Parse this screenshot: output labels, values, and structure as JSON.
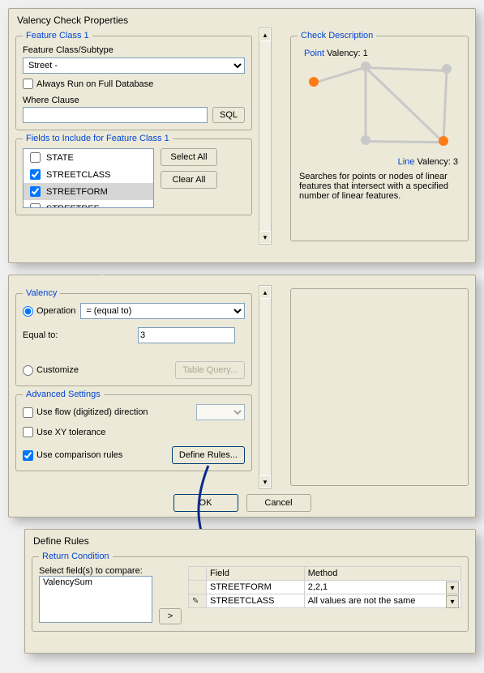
{
  "dialog1": {
    "title": "Valency Check Properties",
    "featureClass": {
      "legend": "Feature Class 1",
      "subtypeLabel": "Feature Class/Subtype",
      "subtypeValue": "Street - ",
      "alwaysRun": {
        "label": "Always Run on Full Database",
        "checked": false
      },
      "whereLabel": "Where Clause",
      "whereValue": "",
      "sqlBtn": "SQL"
    },
    "fields": {
      "legend": "Fields to Include for Feature Class 1",
      "items": [
        {
          "label": "STATE",
          "checked": false,
          "selected": false
        },
        {
          "label": "STREETCLASS",
          "checked": true,
          "selected": false
        },
        {
          "label": "STREETFORM",
          "checked": true,
          "selected": true
        },
        {
          "label": "STREETREF",
          "checked": false,
          "selected": false
        }
      ],
      "selectAll": "Select All",
      "clearAll": "Clear All"
    },
    "checkDesc": {
      "legend": "Check Description",
      "pointLabel": "Point",
      "pointValency": "Valency: 1",
      "lineLabel": "Line",
      "lineValency": "Valency: 3",
      "text": "Searches for points or nodes of linear features that intersect with a specified number of linear features."
    }
  },
  "dialog2": {
    "valency": {
      "legend": "Valency",
      "operation": {
        "label": "Operation",
        "value": "= (equal to)",
        "selected": true
      },
      "equalToLabel": "Equal to:",
      "equalToValue": "3",
      "customize": {
        "label": "Customize",
        "selected": false
      },
      "tableQueryBtn": "Table Query..."
    },
    "advanced": {
      "legend": "Advanced Settings",
      "flow": {
        "label": "Use flow (digitized) direction",
        "checked": false
      },
      "xy": {
        "label": "Use XY tolerance",
        "checked": false
      },
      "compare": {
        "label": "Use comparison rules",
        "checked": true
      },
      "defineRulesBtn": "Define Rules..."
    },
    "ok": "OK",
    "cancel": "Cancel"
  },
  "defineRules": {
    "title": "Define Rules",
    "returnCond": {
      "legend": "Return Condition",
      "selectLabel": "Select field(s) to compare:",
      "listItems": [
        "ValencySum"
      ],
      "moveBtn": ">"
    },
    "grid": {
      "colField": "Field",
      "colMethod": "Method",
      "rows": [
        {
          "field": "STREETFORM",
          "method": "2,2,1",
          "editing": false
        },
        {
          "field": "STREETCLASS",
          "method": "All values are not the same",
          "editing": true
        }
      ]
    }
  },
  "chart_data": {
    "type": "diagram",
    "title": "Valency Check",
    "nodes": [
      {
        "id": "A",
        "x": 0.08,
        "y": 0.3,
        "highlight": true,
        "label": "Point Valency: 1"
      },
      {
        "id": "B",
        "x": 0.4,
        "y": 0.15
      },
      {
        "id": "C",
        "x": 0.9,
        "y": 0.18
      },
      {
        "id": "D",
        "x": 0.4,
        "y": 0.85
      },
      {
        "id": "E",
        "x": 0.88,
        "y": 0.86,
        "highlight": true,
        "label": "Line Valency: 3"
      }
    ],
    "edges": [
      [
        "A",
        "B"
      ],
      [
        "B",
        "C"
      ],
      [
        "B",
        "D"
      ],
      [
        "D",
        "E"
      ],
      [
        "C",
        "E"
      ],
      [
        "B",
        "E"
      ]
    ]
  }
}
